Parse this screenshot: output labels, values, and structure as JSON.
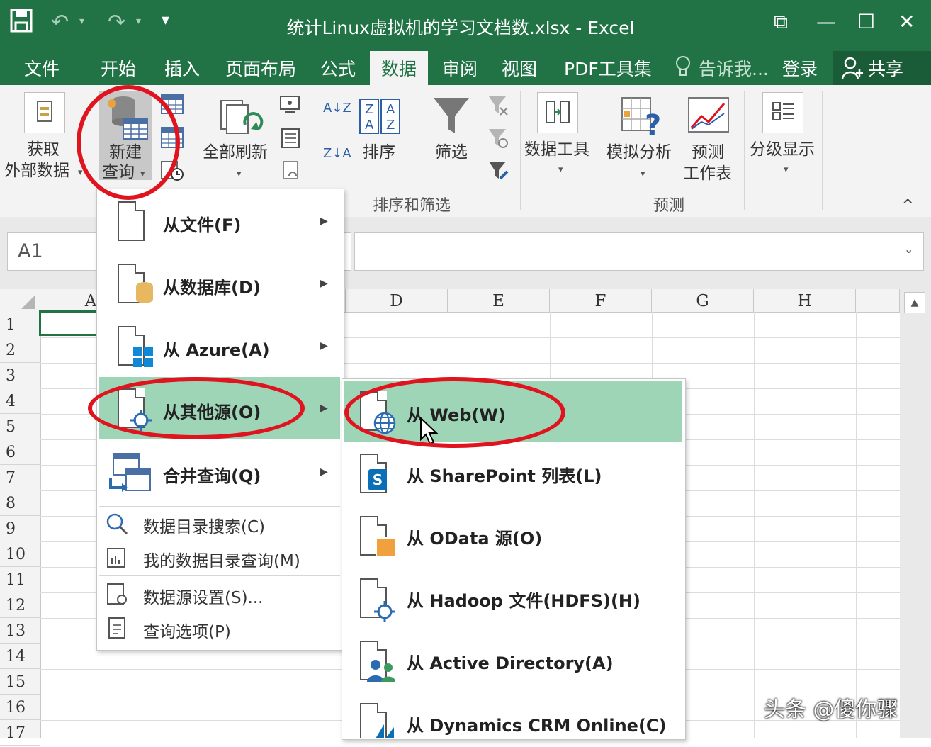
{
  "window": {
    "title": "统计Linux虚拟机的学习文档数.xlsx - Excel",
    "controls": {
      "ribbon_display": "⧉",
      "minimize": "—",
      "maximize": "☐",
      "close": "✕"
    }
  },
  "qat": {
    "save": "💾",
    "undo": "↶",
    "redo": "↷",
    "customize": "▾",
    "dropdown": "▾"
  },
  "tabs": [
    {
      "label": "文件",
      "active": false
    },
    {
      "label": "开始",
      "active": false
    },
    {
      "label": "插入",
      "active": false
    },
    {
      "label": "页面布局",
      "active": false
    },
    {
      "label": "公式",
      "active": false
    },
    {
      "label": "数据",
      "active": true
    },
    {
      "label": "审阅",
      "active": false
    },
    {
      "label": "视图",
      "active": false
    },
    {
      "label": "PDF工具集",
      "active": false
    }
  ],
  "tell_me": "告诉我...",
  "signin": "登录",
  "share": "共享",
  "ribbon": {
    "get_external_line1": "获取",
    "get_external_line2": "外部数据",
    "new_query_line1": "新建",
    "new_query_line2": "查询",
    "refresh_all": "全部刷新",
    "sort": "排序",
    "filter": "筛选",
    "sort_az": "A↓Z",
    "sort_za": "Z↓A",
    "data_tools": "数据工具",
    "what_if": "模拟分析",
    "forecast_line1": "预测",
    "forecast_line2": "工作表",
    "outline": "分级显示",
    "group_sort_filter": "排序和筛选",
    "group_forecast": "预测",
    "collapse": "^"
  },
  "name_box": "A1",
  "columns": [
    "A",
    "D",
    "E",
    "F",
    "G",
    "H"
  ],
  "rows": [
    "1",
    "2",
    "3",
    "4",
    "5",
    "6",
    "7",
    "8",
    "9",
    "10",
    "11",
    "12",
    "13",
    "14",
    "15",
    "16",
    "17"
  ],
  "menu_new_query": {
    "items": [
      {
        "label": "从文件(F)"
      },
      {
        "label": "从数据库(D)"
      },
      {
        "label": "从 Azure(A)"
      },
      {
        "label": "从其他源(O)",
        "highlighted": true
      },
      {
        "label": "合并查询(Q)"
      }
    ],
    "commands": [
      {
        "label": "数据目录搜索(C)"
      },
      {
        "label": "我的数据目录查询(M)"
      },
      {
        "label": "数据源设置(S)..."
      },
      {
        "label": "查询选项(P)"
      }
    ]
  },
  "menu_other_sources": {
    "items": [
      {
        "label": "从 Web(W)",
        "highlighted": true
      },
      {
        "label": "从 SharePoint 列表(L)"
      },
      {
        "label": "从 OData 源(O)"
      },
      {
        "label": "从 Hadoop 文件(HDFS)(H)"
      },
      {
        "label": "从 Active Directory(A)"
      },
      {
        "label": "从 Dynamics CRM Online(C)"
      }
    ]
  },
  "watermark": "头条 @傻你骤",
  "colors": {
    "excel_green": "#217346",
    "highlight": "#9fd5b7",
    "annotation_red": "#e0141e"
  }
}
